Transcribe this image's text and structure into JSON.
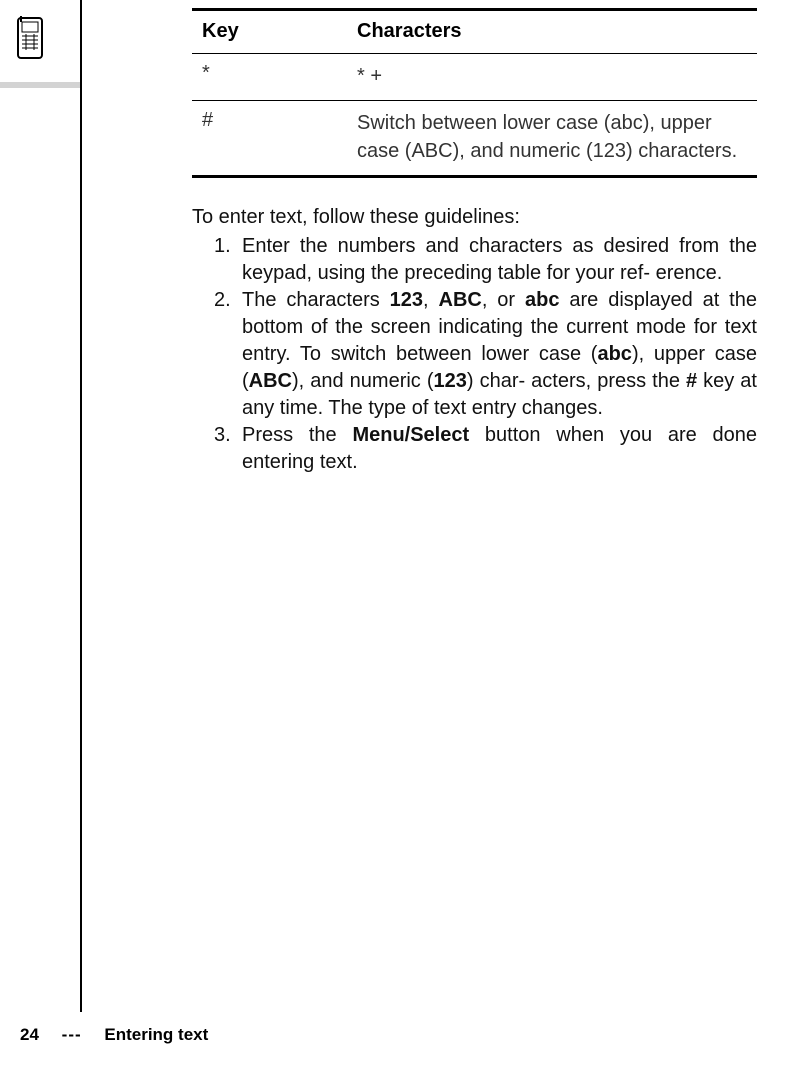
{
  "table": {
    "headers": {
      "key": "Key",
      "chars": "Characters"
    },
    "rows": [
      {
        "key": "*",
        "chars": "* +"
      },
      {
        "key": "#",
        "chars": "Switch between lower case (abc), upper case (ABC), and numeric (123) characters."
      }
    ]
  },
  "intro": "To enter text, follow these guidelines:",
  "steps": [
    {
      "n": "1.",
      "parts": [
        {
          "t": "Enter the numbers and characters as desired from the keypad, using the preceding table for your ref- erence."
        }
      ]
    },
    {
      "n": "2.",
      "parts": [
        {
          "t": "The characters "
        },
        {
          "t": "123",
          "b": true
        },
        {
          "t": ", "
        },
        {
          "t": "ABC",
          "b": true
        },
        {
          "t": ", or "
        },
        {
          "t": "abc",
          "b": true
        },
        {
          "t": " are displayed at the bottom of the screen indicating the current mode for text entry. To switch between lower case\n("
        },
        {
          "t": "abc",
          "b": true
        },
        {
          "t": "), upper case ("
        },
        {
          "t": "ABC",
          "b": true
        },
        {
          "t": "), and numeric ("
        },
        {
          "t": "123",
          "b": true
        },
        {
          "t": ") char- acters, press the "
        },
        {
          "t": "#",
          "b": true
        },
        {
          "t": " key at any time. The type of text entry changes."
        }
      ]
    },
    {
      "n": "3.",
      "parts": [
        {
          "t": "Press the "
        },
        {
          "t": "Menu/Select",
          "b": true
        },
        {
          "t": " button when you are done entering text."
        }
      ]
    }
  ],
  "footer": {
    "page": "24",
    "sep": "---",
    "title": "Entering text"
  }
}
